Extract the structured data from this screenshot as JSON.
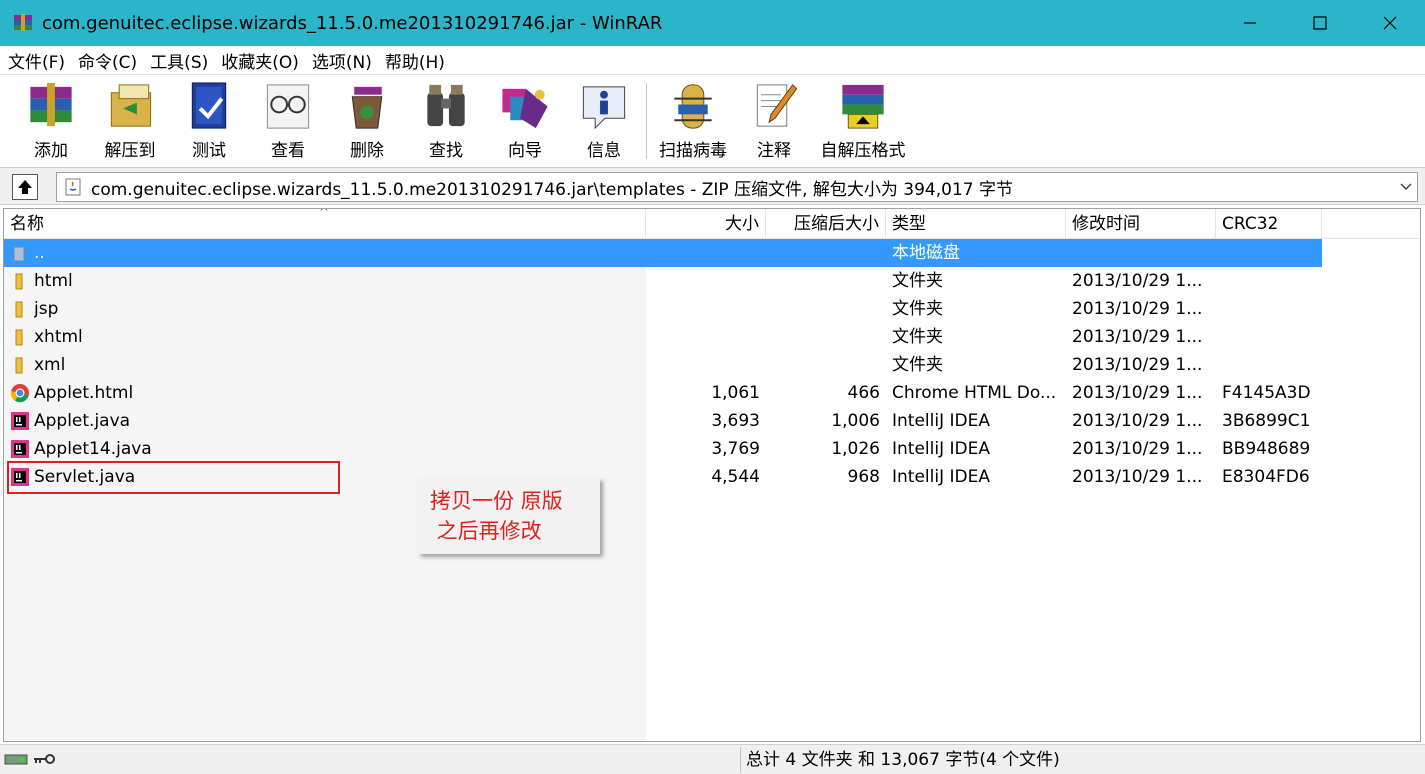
{
  "window": {
    "title": "com.genuitec.eclipse.wizards_11.5.0.me201310291746.jar - WinRAR"
  },
  "menu": [
    "文件(F)",
    "命令(C)",
    "工具(S)",
    "收藏夹(O)",
    "选项(N)",
    "帮助(H)"
  ],
  "toolbar": [
    {
      "label": "添加",
      "icon": "add-archive-icon"
    },
    {
      "label": "解压到",
      "icon": "extract-to-icon"
    },
    {
      "label": "测试",
      "icon": "test-icon"
    },
    {
      "label": "查看",
      "icon": "view-icon"
    },
    {
      "label": "删除",
      "icon": "delete-icon"
    },
    {
      "label": "查找",
      "icon": "find-icon"
    },
    {
      "label": "向导",
      "icon": "wizard-icon"
    },
    {
      "label": "信息",
      "icon": "info-icon"
    },
    {
      "label": "扫描病毒",
      "icon": "virus-scan-icon"
    },
    {
      "label": "注释",
      "icon": "comment-icon"
    },
    {
      "label": "自解压格式",
      "icon": "sfx-icon"
    }
  ],
  "address": {
    "path": "com.genuitec.eclipse.wizards_11.5.0.me201310291746.jar\\templates - ZIP 压缩文件, 解包大小为 394,017 字节"
  },
  "columns": {
    "name": "名称",
    "size": "大小",
    "packed": "压缩后大小",
    "type": "类型",
    "modified": "修改时间",
    "crc": "CRC32"
  },
  "files": [
    {
      "name": "..",
      "size": "",
      "packed": "",
      "type": "本地磁盘",
      "modified": "",
      "crc": "",
      "icon": "parent-folder-icon",
      "selected": true
    },
    {
      "name": "html",
      "size": "",
      "packed": "",
      "type": "文件夹",
      "modified": "2013/10/29 1...",
      "crc": "",
      "icon": "folder-icon"
    },
    {
      "name": "jsp",
      "size": "",
      "packed": "",
      "type": "文件夹",
      "modified": "2013/10/29 1...",
      "crc": "",
      "icon": "folder-icon"
    },
    {
      "name": "xhtml",
      "size": "",
      "packed": "",
      "type": "文件夹",
      "modified": "2013/10/29 1...",
      "crc": "",
      "icon": "folder-icon"
    },
    {
      "name": "xml",
      "size": "",
      "packed": "",
      "type": "文件夹",
      "modified": "2013/10/29 1...",
      "crc": "",
      "icon": "folder-icon"
    },
    {
      "name": "Applet.html",
      "size": "1,061",
      "packed": "466",
      "type": "Chrome HTML Do...",
      "modified": "2013/10/29 1...",
      "crc": "F4145A3D",
      "icon": "chrome-icon"
    },
    {
      "name": "Applet.java",
      "size": "3,693",
      "packed": "1,006",
      "type": "IntelliJ IDEA",
      "modified": "2013/10/29 1...",
      "crc": "3B6899C1",
      "icon": "intellij-icon"
    },
    {
      "name": "Applet14.java",
      "size": "3,769",
      "packed": "1,026",
      "type": "IntelliJ IDEA",
      "modified": "2013/10/29 1...",
      "crc": "BB948689",
      "icon": "intellij-icon"
    },
    {
      "name": "Servlet.java",
      "size": "4,544",
      "packed": "968",
      "type": "IntelliJ IDEA",
      "modified": "2013/10/29 1...",
      "crc": "E8304FD6",
      "icon": "intellij-icon"
    }
  ],
  "annotation": {
    "line1": "拷贝一份 原版",
    "line2": " 之后再修改",
    "color": "#e02020"
  },
  "status": {
    "text": "总计 4 文件夹 和 13,067 字节(4 个文件)"
  },
  "colors": {
    "titlebar": "#2bb5c8",
    "selection": "#3399ff"
  }
}
